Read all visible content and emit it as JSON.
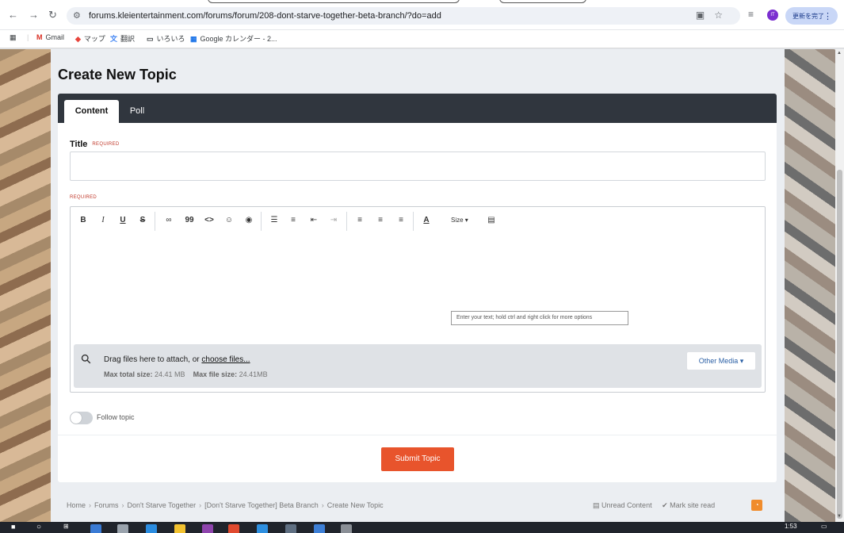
{
  "browser": {
    "url": "forums.kleientertainment.com/forums/forum/208-dont-starve-together-beta-branch/?do=add",
    "profile_initials": "IT",
    "update_button": "更新を完了"
  },
  "bookmarks": [
    {
      "icon": "M",
      "label": "Gmail"
    },
    {
      "icon": "◆",
      "label": "マップ"
    },
    {
      "icon": "文",
      "label": "翻訳"
    },
    {
      "icon": "▭",
      "label": "いろいろ"
    },
    {
      "icon": "▦",
      "label": "Google カレンダー - 2..."
    }
  ],
  "page": {
    "title": "Create New Topic",
    "tabs": [
      "Content",
      "Poll"
    ],
    "title_field_label": "Title",
    "required_label": "REQUIRED",
    "editor_required_label": "REQUIRED",
    "toolbar": {
      "bold": "B",
      "italic": "I",
      "underline": "U",
      "strike": "S",
      "quote": "99",
      "code": "<>",
      "size": "Size ▾"
    },
    "editor_placeholder": "Enter your text; hold ctrl and right click for more options",
    "attach": {
      "text": "Drag files here to attach, or",
      "link": "choose files...",
      "max_total_label": "Max total size:",
      "max_total_value": "24.41 MB",
      "max_file_label": "Max file size:",
      "max_file_value": "24.41MB",
      "other_media": "Other Media ▾"
    },
    "follow_label": "Follow topic",
    "submit_label": "Submit Topic"
  },
  "breadcrumb": [
    "Home",
    "Forums",
    "Don't Starve Together",
    "[Don't Starve Together] Beta Branch",
    "Create New Topic"
  ],
  "footer_links": {
    "unread": "Unread Content",
    "mark_read": "Mark site read"
  },
  "taskbar": {
    "time": "1:53"
  }
}
